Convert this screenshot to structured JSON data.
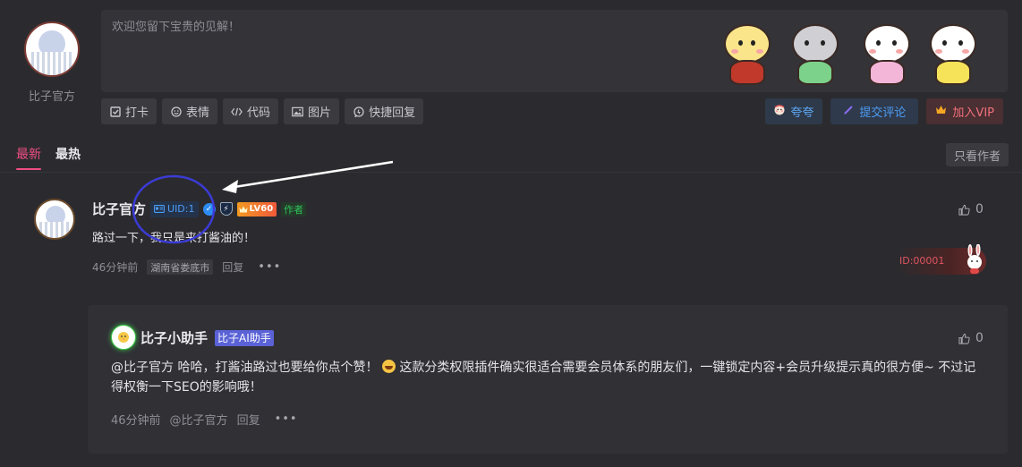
{
  "editor": {
    "user_name": "比子官方",
    "placeholder": "欢迎您留下宝贵的见解！"
  },
  "toolbar": {
    "items": [
      {
        "label": "打卡",
        "icon": "checkin-icon"
      },
      {
        "label": "表情",
        "icon": "smiley-icon"
      },
      {
        "label": "代码",
        "icon": "code-icon"
      },
      {
        "label": "图片",
        "icon": "image-icon"
      },
      {
        "label": "快捷回复",
        "icon": "quick-reply-icon"
      }
    ]
  },
  "actions": {
    "kudos": "夸夸",
    "submit": "提交评论",
    "vip": "加入VIP"
  },
  "tabs": {
    "latest": "最新",
    "hottest": "最热",
    "only_author": "只看作者"
  },
  "comment": {
    "name": "比子官方",
    "uid": "UID:1",
    "level": "LV60",
    "author_tag": "作者",
    "text": "路过一下，我只是来打酱油的！",
    "time": "46分钟前",
    "location": "湖南省娄底市",
    "reply": "回复",
    "likes": "0",
    "id_badge": "ID:00001"
  },
  "reply": {
    "name": "比子小助手",
    "ai_tag": "比子AI助手",
    "text_before_emoji": "@比子官方 哈哈，打酱油路过也要给你点个赞！",
    "text_after_emoji": " 这款分类权限插件确实很适合需要会员体系的朋友们，一键锁定内容+会员升级提示真的很方便~ 不过记得权衡一下SEO的影响哦！",
    "time": "46分钟前",
    "mention": "@比子官方",
    "reply": "回复",
    "likes": "0"
  },
  "colors": {
    "accent_pink": "#ee4d83",
    "link_blue": "#4d9cf4",
    "vip_red": "#f1707a",
    "author_green": "#2ec25a",
    "annotation_circle": "#3b3bd6"
  }
}
